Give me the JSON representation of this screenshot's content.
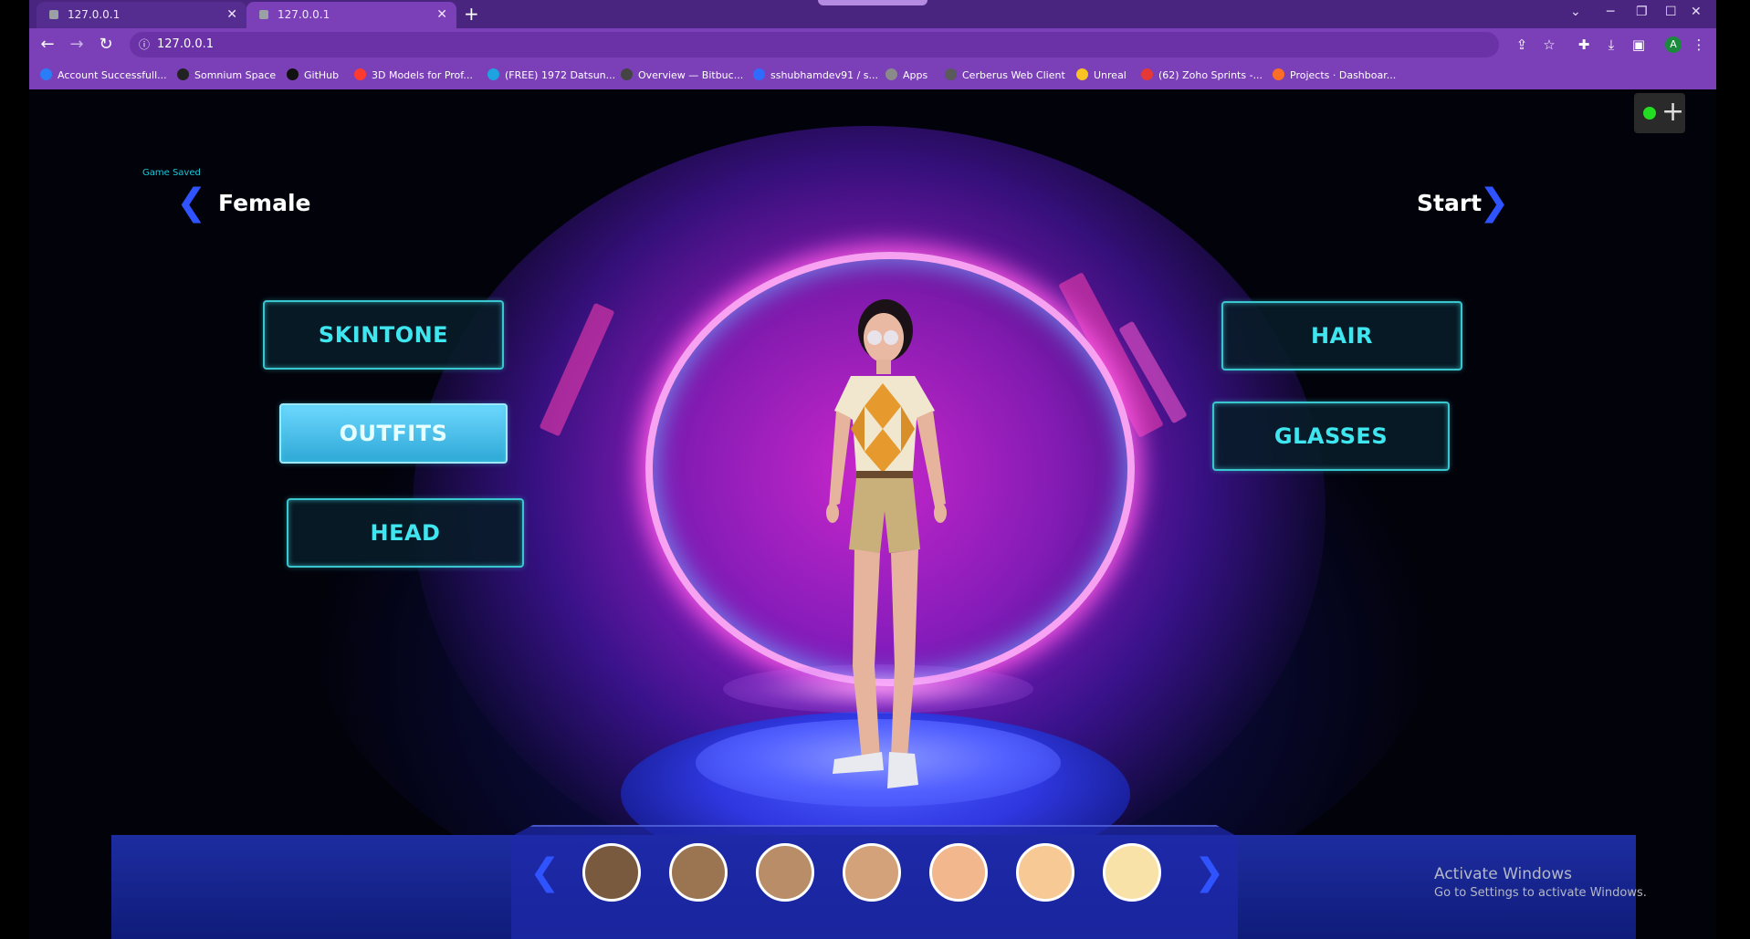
{
  "browser": {
    "tabs": [
      {
        "title": "127.0.0.1",
        "active": false
      },
      {
        "title": "127.0.0.1",
        "active": true
      }
    ],
    "url": "127.0.0.1",
    "profile_initial": "A",
    "bookmarks": [
      {
        "label": "Account Successfull...",
        "color": "#2a7df6"
      },
      {
        "label": "Somnium Space",
        "color": "#222222"
      },
      {
        "label": "GitHub",
        "color": "#111111"
      },
      {
        "label": "3D Models for Prof...",
        "color": "#ff3b30"
      },
      {
        "label": "(FREE) 1972 Datsun...",
        "color": "#1fa3e0"
      },
      {
        "label": "Overview — Bitbuc...",
        "color": "#444444"
      },
      {
        "label": "sshubhamdev91 / s...",
        "color": "#2f6bff"
      },
      {
        "label": "Apps",
        "color": "#8a8a8a"
      },
      {
        "label": "Cerberus Web Client",
        "color": "#5a5a5a"
      },
      {
        "label": "Unreal",
        "color": "#f7c325"
      },
      {
        "label": "(62) Zoho Sprints -...",
        "color": "#e53935"
      },
      {
        "label": "Projects · Dashboar...",
        "color": "#fc6d26"
      }
    ]
  },
  "game": {
    "status_text": "Game Saved",
    "gender_label": "Female",
    "start_label": "Start",
    "left_buttons": [
      {
        "label": "SKINTONE",
        "selected": false
      },
      {
        "label": "OUTFITS",
        "selected": true
      },
      {
        "label": "HEAD",
        "selected": false
      }
    ],
    "right_buttons": [
      {
        "label": "HAIR",
        "selected": false
      },
      {
        "label": "GLASSES",
        "selected": false
      }
    ],
    "skin_swatches": [
      "#7a5a3f",
      "#9b7452",
      "#b98d68",
      "#d4a27a",
      "#f2b78d",
      "#f6c995",
      "#f8e2a8"
    ],
    "accent_color": "#3fe6ef"
  },
  "overlay": {
    "activate_title": "Activate Windows",
    "activate_subtitle": "Go to Settings to activate Windows."
  }
}
